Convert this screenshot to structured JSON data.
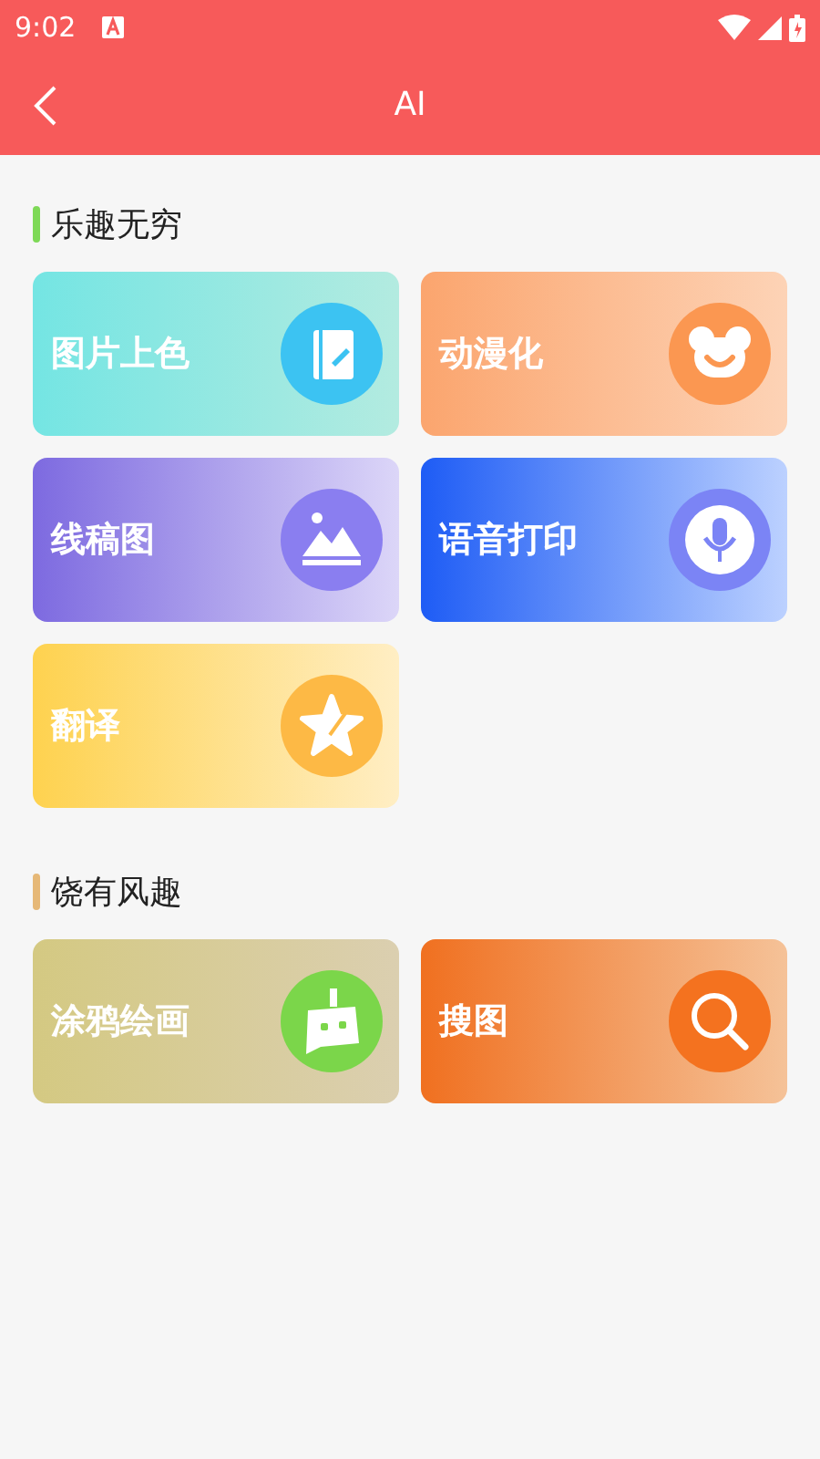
{
  "status_bar": {
    "time": "9:02"
  },
  "app_bar": {
    "title": "AI"
  },
  "sections": [
    {
      "title": "乐趣无穷",
      "color": "#7ed957",
      "cards": [
        {
          "label": "图片上色",
          "kind": "colorize"
        },
        {
          "label": "动漫化",
          "kind": "bear"
        },
        {
          "label": "线稿图",
          "kind": "landscape"
        },
        {
          "label": "语音打印",
          "kind": "mic"
        },
        {
          "label": "翻译",
          "kind": "star"
        }
      ]
    },
    {
      "title": "饶有风趣",
      "color": "#e6b877",
      "cards": [
        {
          "label": "涂鸦绘画",
          "kind": "robot"
        },
        {
          "label": "搜图",
          "kind": "search"
        }
      ]
    }
  ]
}
